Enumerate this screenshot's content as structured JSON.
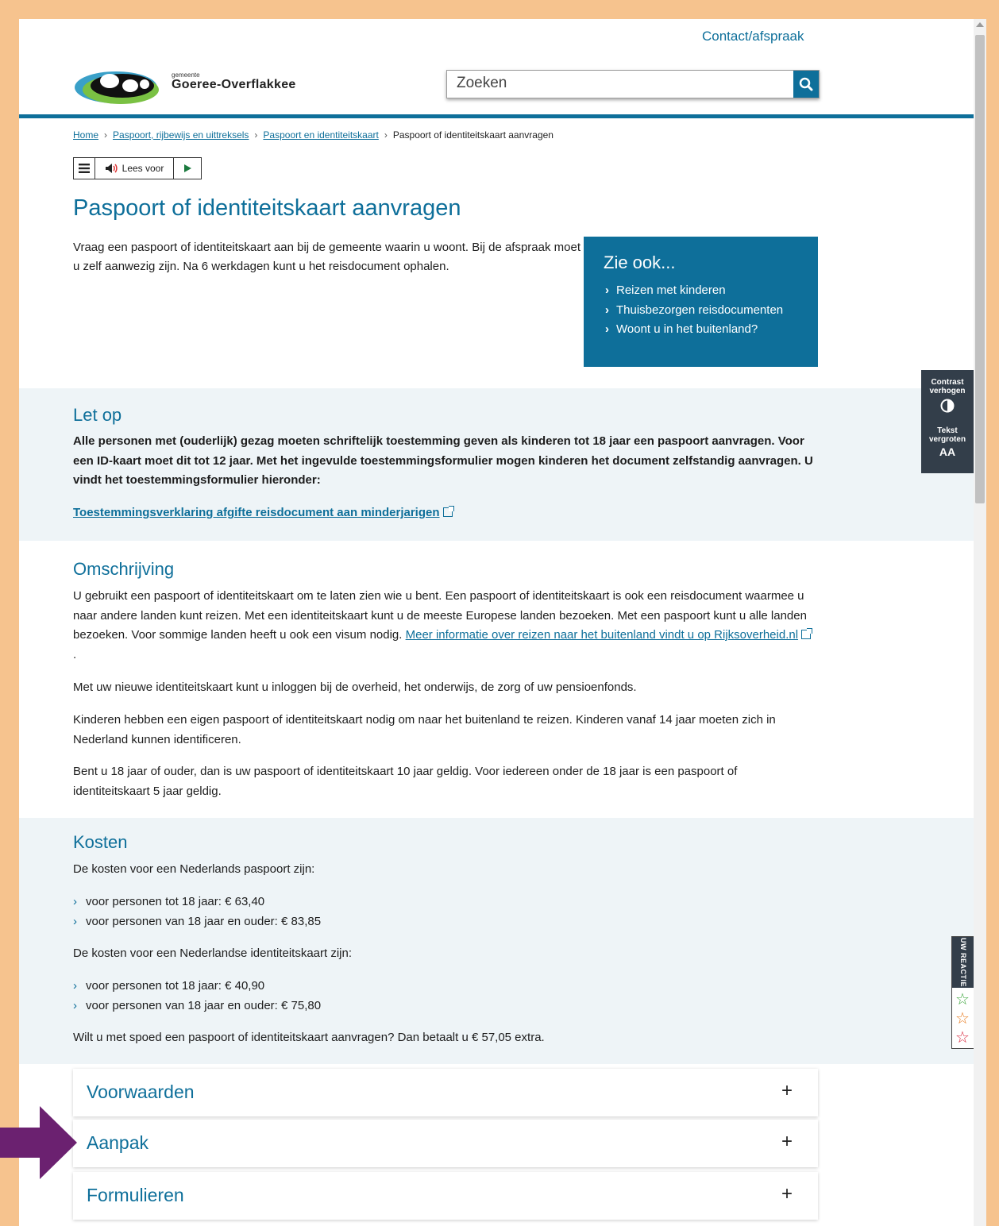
{
  "header": {
    "contact_link": "Contact/afspraak",
    "logo_small": "gemeente",
    "logo_name": "Goeree-Overflakkee",
    "search_placeholder": "Zoeken"
  },
  "breadcrumb": {
    "items": [
      "Home",
      "Paspoort, rijbewijs en uittreksels",
      "Paspoort en identiteitskaart"
    ],
    "current": "Paspoort of identiteitskaart aanvragen"
  },
  "readspeaker": {
    "label": "Lees voor"
  },
  "page": {
    "title": "Paspoort of identiteitskaart aanvragen",
    "intro": "Vraag een paspoort of identiteitskaart aan bij de gemeente waarin u woont. Bij de afspraak moet u zelf aanwezig zijn. Na 6 werkdagen kunt u het reisdocument ophalen."
  },
  "zie_ook": {
    "title": "Zie ook...",
    "links": [
      "Reizen met kinderen",
      "Thuisbezorgen reisdocumenten",
      "Woont u in het buitenland?"
    ]
  },
  "let_op": {
    "title": "Let op",
    "text": "Alle personen met (ouderlijk) gezag moeten schriftelijk toestemming geven als kinderen tot 18 jaar een paspoort aanvragen. Voor een ID-kaart moet dit tot 12 jaar. Met het ingevulde toestemmingsformulier mogen kinderen het document zelfstandig aanvragen. U vindt het toestemmingsformulier hieronder:",
    "link": "Toestemmingsverklaring afgifte reisdocument aan minderjarigen"
  },
  "omschrijving": {
    "title": "Omschrijving",
    "p1_text": "U gebruikt een paspoort of identiteitskaart om te laten zien wie u bent. Een paspoort of identiteitskaart is ook een reisdocument waarmee u naar andere landen kunt reizen. Met een identiteitskaart kunt u de meeste Europese landen bezoeken. Met een paspoort kunt u alle landen bezoeken. Voor sommige landen heeft u ook een visum nodig. ",
    "p1_link": "Meer informatie over reizen naar het buitenland vindt u op Rijksoverheid.nl",
    "p1_end": ".",
    "p2": "Met uw nieuwe identiteitskaart kunt u inloggen bij de overheid, het onderwijs, de zorg of uw pensioenfonds.",
    "p3": "Kinderen hebben een eigen paspoort of identiteitskaart nodig om naar het buitenland te reizen. Kinderen vanaf 14 jaar moeten zich in Nederland kunnen identificeren.",
    "p4": "Bent u 18 jaar of ouder, dan is uw paspoort of identiteitskaart 10 jaar geldig. Voor iedereen onder de 18 jaar is een paspoort of identiteitskaart 5 jaar geldig."
  },
  "kosten": {
    "title": "Kosten",
    "paspoort_intro": "De kosten voor een Nederlands paspoort zijn:",
    "paspoort_items": [
      "voor personen tot 18 jaar: € 63,40",
      "voor personen van 18 jaar en ouder: € 83,85"
    ],
    "id_intro": "De kosten voor een Nederlandse identiteitskaart zijn:",
    "id_items": [
      "voor personen tot 18 jaar: € 40,90",
      "voor personen van 18 jaar en ouder: € 75,80"
    ],
    "spoed": "Wilt u met spoed een paspoort of identiteitskaart aanvragen? Dan betaalt u € 57,05 extra."
  },
  "accordion": [
    "Voorwaarden",
    "Aanpak",
    "Formulieren"
  ],
  "tools": {
    "contrast_line1": "Contrast",
    "contrast_line2": "verhogen",
    "text_line1": "Tekst",
    "text_line2": "vergroten",
    "text_icon": "AA"
  },
  "feedback": {
    "label": "UW REACTIE"
  },
  "colors": {
    "brand": "#0e6f9a",
    "band": "#eef4f7",
    "frame": "#f6c38e",
    "arrow": "#6b2170"
  }
}
